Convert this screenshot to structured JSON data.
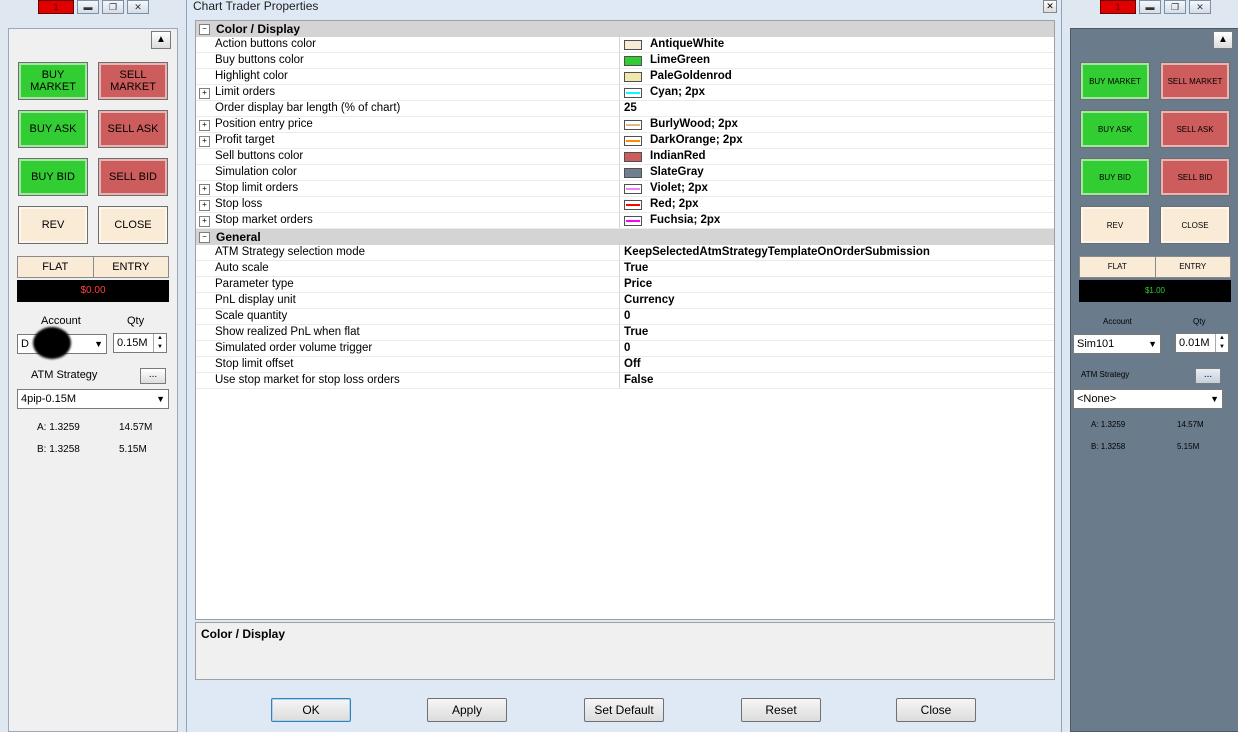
{
  "dialog": {
    "title": "Chart Trader Properties",
    "categories": [
      {
        "name": "Color / Display",
        "toggle": "−",
        "rows": [
          {
            "name": "Action buttons color",
            "value": "AntiqueWhite",
            "swatch": "#faebd7",
            "expand": false
          },
          {
            "name": "Buy buttons color",
            "value": "LimeGreen",
            "swatch": "#32cd32",
            "expand": false
          },
          {
            "name": "Highlight color",
            "value": "PaleGoldenrod",
            "swatch": "#eee8aa",
            "expand": false
          },
          {
            "name": "Limit orders",
            "value": "Cyan; 2px",
            "line": "#00ffff",
            "expand": true
          },
          {
            "name": "Order display bar length (% of chart)",
            "value": "25",
            "expand": false
          },
          {
            "name": "Position entry price",
            "value": "BurlyWood; 2px",
            "line": "#deb887",
            "expand": true
          },
          {
            "name": "Profit target",
            "value": "DarkOrange; 2px",
            "line": "#ff8c00",
            "expand": true
          },
          {
            "name": "Sell buttons color",
            "value": "IndianRed",
            "swatch": "#cd5c5c",
            "expand": false
          },
          {
            "name": "Simulation color",
            "value": "SlateGray",
            "swatch": "#708090",
            "expand": false
          },
          {
            "name": "Stop limit orders",
            "value": "Violet; 2px",
            "line": "#ee82ee",
            "expand": true
          },
          {
            "name": "Stop loss",
            "value": "Red; 2px",
            "line": "#ff0000",
            "expand": true
          },
          {
            "name": "Stop market orders",
            "value": "Fuchsia; 2px",
            "line": "#ff00ff",
            "expand": true
          }
        ]
      },
      {
        "name": "General",
        "toggle": "−",
        "rows": [
          {
            "name": "ATM Strategy selection mode",
            "value": "KeepSelectedAtmStrategyTemplateOnOrderSubmission",
            "expand": false
          },
          {
            "name": "Auto scale",
            "value": "True",
            "expand": false
          },
          {
            "name": "Parameter type",
            "value": "Price",
            "expand": false
          },
          {
            "name": "PnL display unit",
            "value": "Currency",
            "expand": false
          },
          {
            "name": "Scale quantity",
            "value": "0",
            "expand": false
          },
          {
            "name": "Show realized PnL when flat",
            "value": "True",
            "expand": false
          },
          {
            "name": "Simulated order volume trigger",
            "value": "0",
            "expand": false
          },
          {
            "name": "Stop limit offset",
            "value": "Off",
            "expand": false
          },
          {
            "name": "Use stop market for stop loss orders",
            "value": "False",
            "expand": false
          }
        ]
      }
    ],
    "description_title": "Color / Display",
    "buttons": {
      "ok": "OK",
      "apply": "Apply",
      "set_default": "Set Default",
      "reset": "Reset",
      "close": "Close"
    }
  },
  "left_panel": {
    "buttons": {
      "buy_market": "BUY MARKET",
      "sell_market": "SELL MARKET",
      "buy_ask": "BUY ASK",
      "sell_ask": "SELL ASK",
      "buy_bid": "BUY BID",
      "sell_bid": "SELL BID",
      "rev": "REV",
      "close": "CLOSE"
    },
    "position": "FLAT",
    "entry": "ENTRY",
    "pnl": "$0.00",
    "pnl_color": "#ff4040",
    "account_label": "Account",
    "account_value": "D",
    "qty_label": "Qty",
    "qty_value": "0.15M",
    "atm_label": "ATM Strategy",
    "atm_value": "4pip-0.15M",
    "ask": "A: 1.3259",
    "ask_size": "14.57M",
    "bid": "B: 1.3258",
    "bid_size": "5.15M"
  },
  "right_panel": {
    "buttons": {
      "buy_market": "BUY MARKET",
      "sell_market": "SELL MARKET",
      "buy_ask": "BUY ASK",
      "sell_ask": "SELL ASK",
      "buy_bid": "BUY BID",
      "sell_bid": "SELL BID",
      "rev": "REV",
      "close": "CLOSE"
    },
    "position": "FLAT",
    "entry": "ENTRY",
    "pnl": "$1.00",
    "pnl_color": "#32cd32",
    "account_label": "Account",
    "account_value": "Sim101",
    "qty_label": "Qty",
    "qty_value": "0.01M",
    "atm_label": "ATM Strategy",
    "atm_value": "<None>",
    "ask": "A: 1.3259",
    "ask_size": "14.57M",
    "bid": "B: 1.3258",
    "bid_size": "5.15M"
  },
  "icons": {
    "minimize": "minimize-icon",
    "restore": "restore-icon",
    "close": "close-icon",
    "expand": "expand-icon",
    "collapse": "collapse-icon",
    "scroll_up": "scroll-up-icon",
    "dropdown": "chevron-down-icon"
  }
}
